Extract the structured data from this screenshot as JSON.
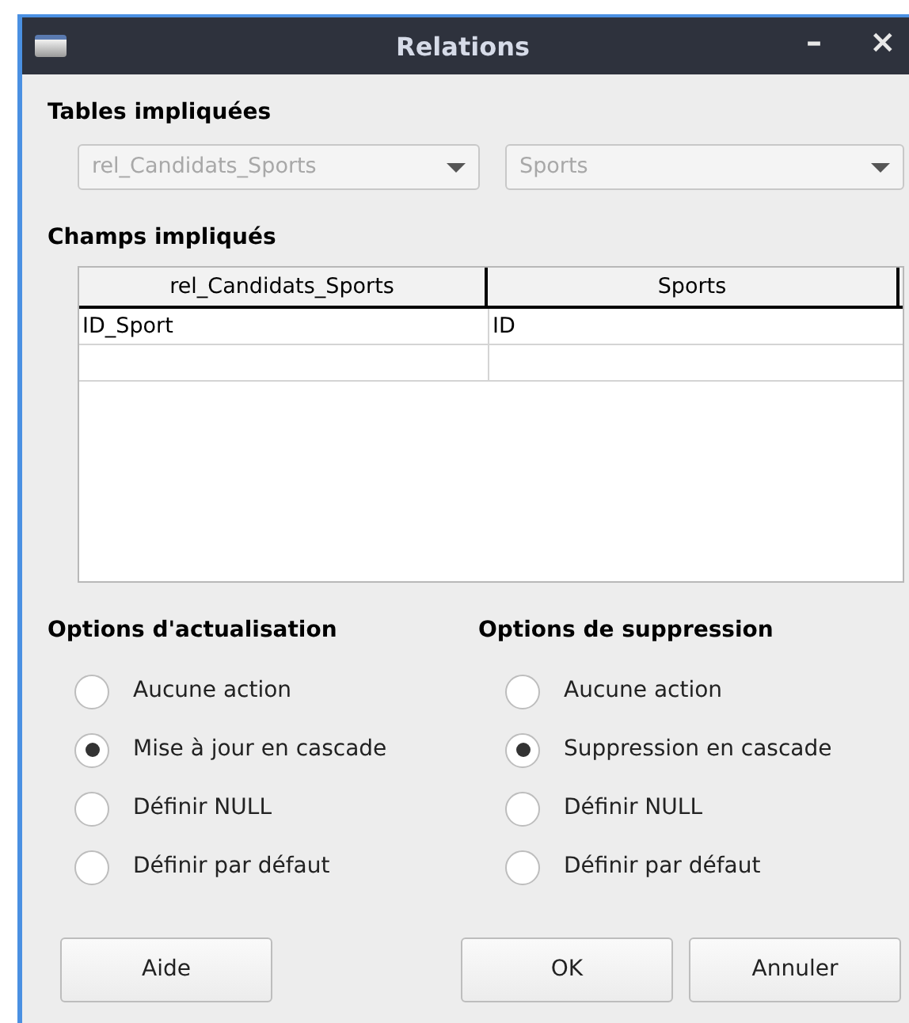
{
  "window": {
    "title": "Relations",
    "controls": [
      "–",
      "×"
    ]
  },
  "tables_section": {
    "heading": "Tables impliquées",
    "dropdowns": [
      {
        "value": "rel_Candidats_Sports",
        "disabled": true
      },
      {
        "value": "Sports",
        "disabled": true
      }
    ]
  },
  "fields_section": {
    "heading": "Champs impliqués",
    "columns": [
      "rel_Candidats_Sports",
      "Sports"
    ],
    "rows": [
      [
        "ID_Sport",
        "ID"
      ]
    ]
  },
  "update_options": {
    "heading": "Options d'actualisation",
    "items": [
      {
        "label": "Aucune action",
        "selected": false
      },
      {
        "label": "Mise à jour en cascade",
        "selected": true
      },
      {
        "label": "Définir NULL",
        "selected": false
      },
      {
        "label": "Définir par défaut",
        "selected": false
      }
    ]
  },
  "delete_options": {
    "heading": "Options de suppression",
    "items": [
      {
        "label": "Aucune action",
        "selected": false
      },
      {
        "label": "Suppression en cascade",
        "selected": true
      },
      {
        "label": "Définir NULL",
        "selected": false
      },
      {
        "label": "Définir par défaut",
        "selected": false
      }
    ]
  },
  "buttons": [
    {
      "label": "Aide"
    },
    {
      "label": "OK"
    },
    {
      "label": "Annuler"
    }
  ]
}
